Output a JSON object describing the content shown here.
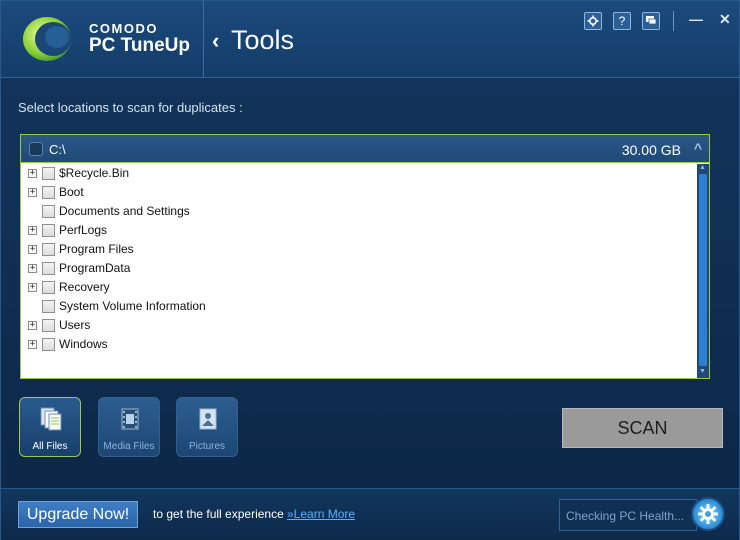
{
  "header": {
    "brand": "COMODO",
    "product": "PC TuneUp",
    "section_title": "Tools",
    "buttons": [
      "gear-icon",
      "help-icon",
      "chat-icon"
    ],
    "minimize_glyph": "—",
    "close_glyph": "✕"
  },
  "main": {
    "instruction": "Select locations to scan for duplicates :",
    "drive": {
      "label": "C:\\",
      "size": "30.00 GB"
    },
    "tree_items": [
      {
        "label": "$Recycle.Bin",
        "expandable": true
      },
      {
        "label": "Boot",
        "expandable": true
      },
      {
        "label": "Documents and Settings",
        "expandable": false
      },
      {
        "label": "PerfLogs",
        "expandable": true
      },
      {
        "label": "Program Files",
        "expandable": true
      },
      {
        "label": "ProgramData",
        "expandable": true
      },
      {
        "label": "Recovery",
        "expandable": true
      },
      {
        "label": "System Volume Information",
        "expandable": false
      },
      {
        "label": "Users",
        "expandable": true
      },
      {
        "label": "Windows",
        "expandable": true
      }
    ],
    "file_types": [
      {
        "label": "All Files",
        "active": true,
        "icon": "documents-icon"
      },
      {
        "label": "Media Files",
        "active": false,
        "icon": "film-icon"
      },
      {
        "label": "Pictures",
        "active": false,
        "icon": "picture-icon"
      }
    ],
    "scan_label": "SCAN"
  },
  "footer": {
    "upgrade_label": "Upgrade Now!",
    "text": "to get the full experience",
    "learn_more": "»Learn More",
    "health_text": "Checking PC Health..."
  },
  "colors": {
    "accent_green": "#9fc84b",
    "header_blue": "#1b4a7c",
    "link_blue": "#5ab0ff"
  }
}
